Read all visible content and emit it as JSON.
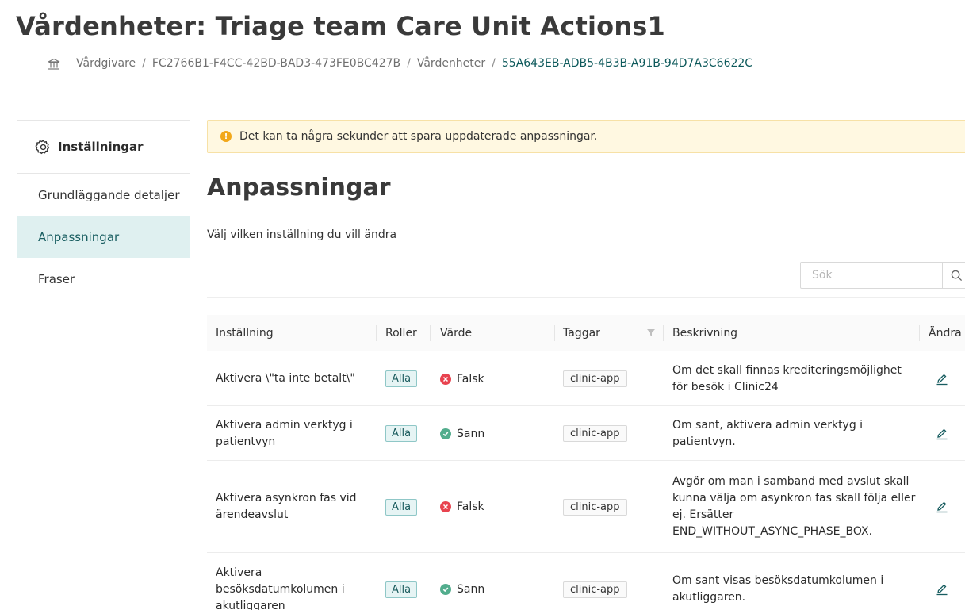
{
  "header": {
    "title": "Vårdenheter: Triage team Care Unit Actions1",
    "breadcrumb": {
      "home_icon": "bank-icon",
      "items": [
        "Vårdgivare",
        "FC2766B1-F4CC-42BD-BAD3-473FE0BC427B",
        "Vårdenheter"
      ],
      "separator": "/",
      "current": "55A643EB-ADB5-4B3B-A91B-94D7A3C6622C"
    }
  },
  "sidebar": {
    "title": "Inställningar",
    "icon": "gear-icon",
    "items": [
      {
        "label": "Grundläggande detaljer",
        "active": false
      },
      {
        "label": "Anpassningar",
        "active": true
      },
      {
        "label": "Fraser",
        "active": false
      }
    ]
  },
  "notice": {
    "text": "Det kan ta några sekunder att spara uppdaterade anpassningar.",
    "icon": "warning-icon",
    "icon_glyph": "!"
  },
  "section": {
    "title": "Anpassningar",
    "subtitle": "Välj vilken inställning du vill ändra"
  },
  "search": {
    "placeholder": "Sök",
    "icon": "search-icon"
  },
  "table": {
    "columns": [
      "Inställning",
      "Roller",
      "Värde",
      "Taggar",
      "Beskrivning",
      "Ändra"
    ],
    "rows": [
      {
        "name_lines": [
          "Aktivera \\\"ta inte betalt\\\""
        ],
        "role": "Alla",
        "value": "Falsk",
        "tag": "clinic-app",
        "desc_lines": [
          "Om det skall finnas krediteringsmöjlighet",
          "för besök i Clinic24"
        ]
      },
      {
        "name_lines": [
          "Aktivera admin verktyg i",
          "patientvyn"
        ],
        "role": "Alla",
        "value": "Sann",
        "tag": "clinic-app",
        "desc_lines": [
          "Om sant, aktivera admin verktyg i",
          "patientvyn."
        ]
      },
      {
        "name_lines": [
          "Aktivera asynkron fas vid",
          "ärendeavslut"
        ],
        "role": "Alla",
        "value": "Falsk",
        "tag": "clinic-app",
        "desc_lines": [
          "Avgör om man i samband med avslut skall",
          "kunna välja om asynkron fas skall följa eller",
          "ej. Ersätter",
          "END_WITHOUT_ASYNC_PHASE_BOX."
        ]
      },
      {
        "name_lines": [
          "Aktivera",
          "besöksdatumkolumen i",
          "akutliggaren"
        ],
        "role": "Alla",
        "value": "Sann",
        "tag": "clinic-app",
        "desc_lines": [
          "Om sant visas besöksdatumkolumen i",
          "akutliggaren."
        ]
      }
    ]
  },
  "colors": {
    "accent": "#185d60",
    "active_bg": "#dff0f0",
    "false_red": "#e8434f",
    "true_green": "#52ad8d",
    "notice_bg": "#fff8e1"
  }
}
